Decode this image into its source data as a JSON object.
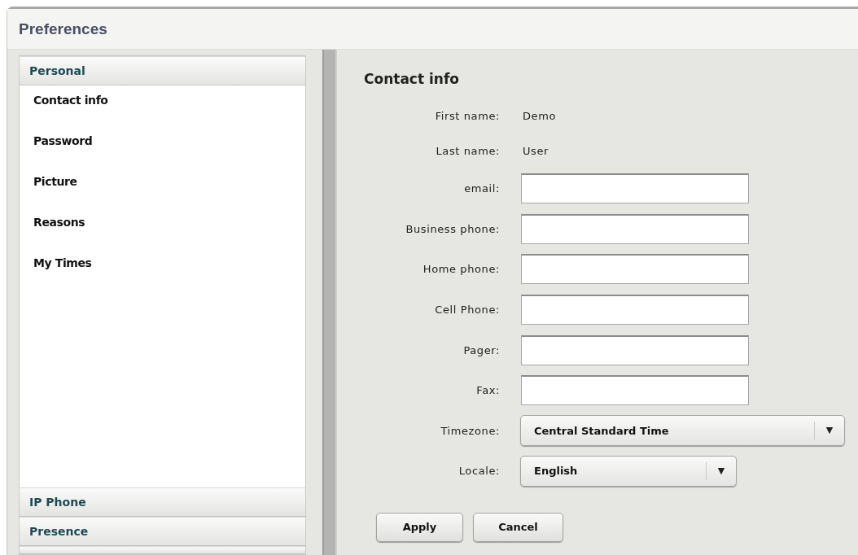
{
  "window": {
    "title": "Preferences"
  },
  "sidebar": {
    "sections": [
      {
        "label": "Personal",
        "expanded": true,
        "items": [
          {
            "label": "Contact info"
          },
          {
            "label": "Password"
          },
          {
            "label": "Picture"
          },
          {
            "label": "Reasons"
          },
          {
            "label": "My Times"
          }
        ]
      },
      {
        "label": "IP Phone",
        "expanded": false
      },
      {
        "label": "Presence",
        "expanded": false
      }
    ]
  },
  "form": {
    "heading": "Contact info",
    "fields": [
      {
        "kind": "text",
        "label": "First name:",
        "value": "Demo"
      },
      {
        "kind": "text",
        "label": "Last name:",
        "value": "User"
      },
      {
        "kind": "input",
        "label": "email:"
      },
      {
        "kind": "input",
        "label": "Business phone:"
      },
      {
        "kind": "input",
        "label": "Home phone:"
      },
      {
        "kind": "input",
        "label": "Cell Phone:"
      },
      {
        "kind": "input",
        "label": "Pager:"
      },
      {
        "kind": "input",
        "label": "Fax:"
      },
      {
        "kind": "select",
        "label": "Timezone:",
        "value": "Central Standard Time",
        "arrow": "▼",
        "wide": true
      },
      {
        "kind": "select",
        "label": "Locale:",
        "value": "English",
        "arrow": "▼",
        "wide": false
      }
    ],
    "buttons": [
      "Apply",
      "Cancel"
    ]
  }
}
